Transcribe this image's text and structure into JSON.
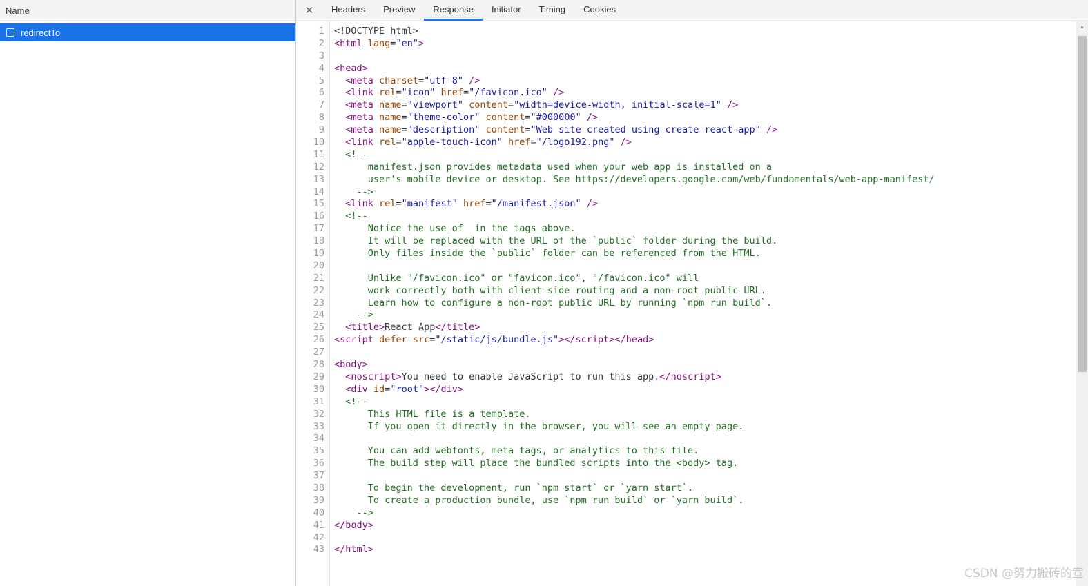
{
  "left_panel": {
    "header": "Name",
    "rows": [
      {
        "label": "redirectTo",
        "selected": true
      }
    ]
  },
  "tabs": {
    "close_glyph": "✕",
    "items": [
      {
        "label": "Headers",
        "active": false
      },
      {
        "label": "Preview",
        "active": false
      },
      {
        "label": "Response",
        "active": true
      },
      {
        "label": "Initiator",
        "active": false
      },
      {
        "label": "Timing",
        "active": false
      },
      {
        "label": "Cookies",
        "active": false
      }
    ]
  },
  "colors": {
    "accent": "#1a73e8",
    "selected_row_bg": "#1a73e8",
    "tab_bar_bg": "#f3f3f3",
    "tag": "#881280",
    "attribute": "#994500",
    "value": "#1a1aa6",
    "comment": "#236e25",
    "plain_text": "#303942",
    "line_number": "#9a9a9a"
  },
  "scrollbar": {
    "up_arrow_glyph": "▲"
  },
  "watermark": "CSDN @努力搬砖的宣",
  "code": {
    "lines": [
      [
        [
          "x",
          "<!DOCTYPE html>"
        ]
      ],
      [
        [
          "t",
          "<html "
        ],
        [
          "a",
          "lang"
        ],
        [
          "x",
          "="
        ],
        [
          "v",
          "\"en\""
        ],
        [
          "t",
          ">"
        ]
      ],
      [],
      [
        [
          "t",
          "<head>"
        ]
      ],
      [
        [
          "x",
          "  "
        ],
        [
          "t",
          "<meta "
        ],
        [
          "a",
          "charset"
        ],
        [
          "x",
          "="
        ],
        [
          "v",
          "\"utf-8\""
        ],
        [
          "t",
          " />"
        ]
      ],
      [
        [
          "x",
          "  "
        ],
        [
          "t",
          "<link "
        ],
        [
          "a",
          "rel"
        ],
        [
          "x",
          "="
        ],
        [
          "v",
          "\"icon\""
        ],
        [
          "a",
          " href"
        ],
        [
          "x",
          "="
        ],
        [
          "v",
          "\"/favicon.ico\""
        ],
        [
          "t",
          " />"
        ]
      ],
      [
        [
          "x",
          "  "
        ],
        [
          "t",
          "<meta "
        ],
        [
          "a",
          "name"
        ],
        [
          "x",
          "="
        ],
        [
          "v",
          "\"viewport\""
        ],
        [
          "a",
          " content"
        ],
        [
          "x",
          "="
        ],
        [
          "v",
          "\"width=device-width, initial-scale=1\""
        ],
        [
          "t",
          " />"
        ]
      ],
      [
        [
          "x",
          "  "
        ],
        [
          "t",
          "<meta "
        ],
        [
          "a",
          "name"
        ],
        [
          "x",
          "="
        ],
        [
          "v",
          "\"theme-color\""
        ],
        [
          "a",
          " content"
        ],
        [
          "x",
          "="
        ],
        [
          "v",
          "\"#000000\""
        ],
        [
          "t",
          " />"
        ]
      ],
      [
        [
          "x",
          "  "
        ],
        [
          "t",
          "<meta "
        ],
        [
          "a",
          "name"
        ],
        [
          "x",
          "="
        ],
        [
          "v",
          "\"description\""
        ],
        [
          "a",
          " content"
        ],
        [
          "x",
          "="
        ],
        [
          "v",
          "\"Web site created using create-react-app\""
        ],
        [
          "t",
          " />"
        ]
      ],
      [
        [
          "x",
          "  "
        ],
        [
          "t",
          "<link "
        ],
        [
          "a",
          "rel"
        ],
        [
          "x",
          "="
        ],
        [
          "v",
          "\"apple-touch-icon\""
        ],
        [
          "a",
          " href"
        ],
        [
          "x",
          "="
        ],
        [
          "v",
          "\"/logo192.png\""
        ],
        [
          "t",
          " />"
        ]
      ],
      [
        [
          "c",
          "  <!--"
        ]
      ],
      [
        [
          "c",
          "      manifest.json provides metadata used when your web app is installed on a"
        ]
      ],
      [
        [
          "c",
          "      user's mobile device or desktop. See https://developers.google.com/web/fundamentals/web-app-manifest/"
        ]
      ],
      [
        [
          "c",
          "    -->"
        ]
      ],
      [
        [
          "x",
          "  "
        ],
        [
          "t",
          "<link "
        ],
        [
          "a",
          "rel"
        ],
        [
          "x",
          "="
        ],
        [
          "v",
          "\"manifest\""
        ],
        [
          "a",
          " href"
        ],
        [
          "x",
          "="
        ],
        [
          "v",
          "\"/manifest.json\""
        ],
        [
          "t",
          " />"
        ]
      ],
      [
        [
          "c",
          "  <!--"
        ]
      ],
      [
        [
          "c",
          "      Notice the use of  in the tags above."
        ]
      ],
      [
        [
          "c",
          "      It will be replaced with the URL of the `public` folder during the build."
        ]
      ],
      [
        [
          "c",
          "      Only files inside the `public` folder can be referenced from the HTML."
        ]
      ],
      [],
      [
        [
          "c",
          "      Unlike \"/favicon.ico\" or \"favicon.ico\", \"/favicon.ico\" will"
        ]
      ],
      [
        [
          "c",
          "      work correctly both with client-side routing and a non-root public URL."
        ]
      ],
      [
        [
          "c",
          "      Learn how to configure a non-root public URL by running `npm run build`."
        ]
      ],
      [
        [
          "c",
          "    -->"
        ]
      ],
      [
        [
          "x",
          "  "
        ],
        [
          "t",
          "<title>"
        ],
        [
          "x",
          "React App"
        ],
        [
          "t",
          "</title>"
        ]
      ],
      [
        [
          "t",
          "<script "
        ],
        [
          "a",
          "defer"
        ],
        [
          "x",
          " "
        ],
        [
          "a",
          "src"
        ],
        [
          "x",
          "="
        ],
        [
          "v",
          "\"/static/js/bundle.js\""
        ],
        [
          "t",
          "></script></head>"
        ]
      ],
      [],
      [
        [
          "t",
          "<body>"
        ]
      ],
      [
        [
          "x",
          "  "
        ],
        [
          "t",
          "<noscript>"
        ],
        [
          "x",
          "You need to enable JavaScript to run this app."
        ],
        [
          "t",
          "</noscript>"
        ]
      ],
      [
        [
          "x",
          "  "
        ],
        [
          "t",
          "<div "
        ],
        [
          "a",
          "id"
        ],
        [
          "x",
          "="
        ],
        [
          "v",
          "\"root\""
        ],
        [
          "t",
          "></div>"
        ]
      ],
      [
        [
          "c",
          "  <!--"
        ]
      ],
      [
        [
          "c",
          "      This HTML file is a template."
        ]
      ],
      [
        [
          "c",
          "      If you open it directly in the browser, you will see an empty page."
        ]
      ],
      [],
      [
        [
          "c",
          "      You can add webfonts, meta tags, or analytics to this file."
        ]
      ],
      [
        [
          "c",
          "      The build step will place the bundled scripts into the <body> tag."
        ]
      ],
      [],
      [
        [
          "c",
          "      To begin the development, run `npm start` or `yarn start`."
        ]
      ],
      [
        [
          "c",
          "      To create a production bundle, use `npm run build` or `yarn build`."
        ]
      ],
      [
        [
          "c",
          "    -->"
        ]
      ],
      [
        [
          "t",
          "</body>"
        ]
      ],
      [],
      [
        [
          "t",
          "</html>"
        ]
      ]
    ]
  }
}
